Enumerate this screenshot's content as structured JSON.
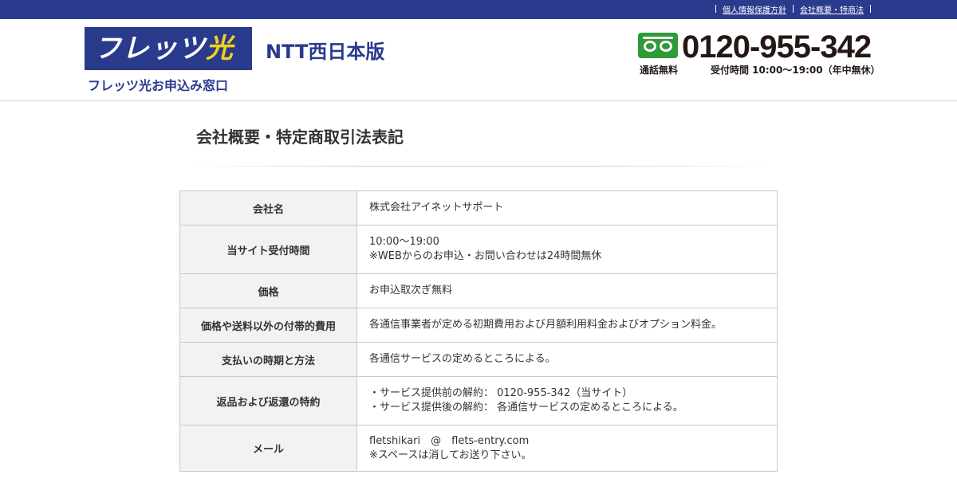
{
  "topbar": {
    "links": [
      "個人情報保護方針",
      "会社概要・特商法"
    ]
  },
  "header": {
    "logo_main": "フレッツ",
    "logo_hikari": "光",
    "logo_sub": "フレッツ光お申込み窓口",
    "region": "NTT西日本版",
    "phone": "0120-955-342",
    "free_call": "通話無料",
    "hours": "受付時間 10:00～19:00（年中無休）",
    "freedial_icon": "freedial-icon"
  },
  "page": {
    "title": "会社概要・特定商取引法表記"
  },
  "table": {
    "rows": [
      {
        "label": "会社名",
        "lines": [
          "株式会社アイネットサポート"
        ]
      },
      {
        "label": "当サイト受付時間",
        "lines": [
          "10:00～19:00",
          "※WEBからのお申込・お問い合わせは24時間無休"
        ]
      },
      {
        "label": "価格",
        "lines": [
          "お申込取次ぎ無料"
        ]
      },
      {
        "label": "価格や送料以外の付帯的費用",
        "lines": [
          "各通信事業者が定める初期費用および月額利用料金およびオプション料金。"
        ]
      },
      {
        "label": "支払いの時期と方法",
        "lines": [
          "各通信サービスの定めるところによる。"
        ]
      },
      {
        "label": "返品および返還の特約",
        "lines": [
          "・サービス提供前の解約： 0120-955-342（当サイト）",
          "・サービス提供後の解約： 各通信サービスの定めるところによる。"
        ]
      },
      {
        "label": "メール",
        "lines": [
          "fletshikari　@　flets-entry.com",
          "※スペースは消してお送り下さい。"
        ]
      }
    ]
  },
  "colors": {
    "brand_navy": "#2a3a8c",
    "logo_yellow": "#f3d21c",
    "freedial_green": "#2e9a38"
  }
}
